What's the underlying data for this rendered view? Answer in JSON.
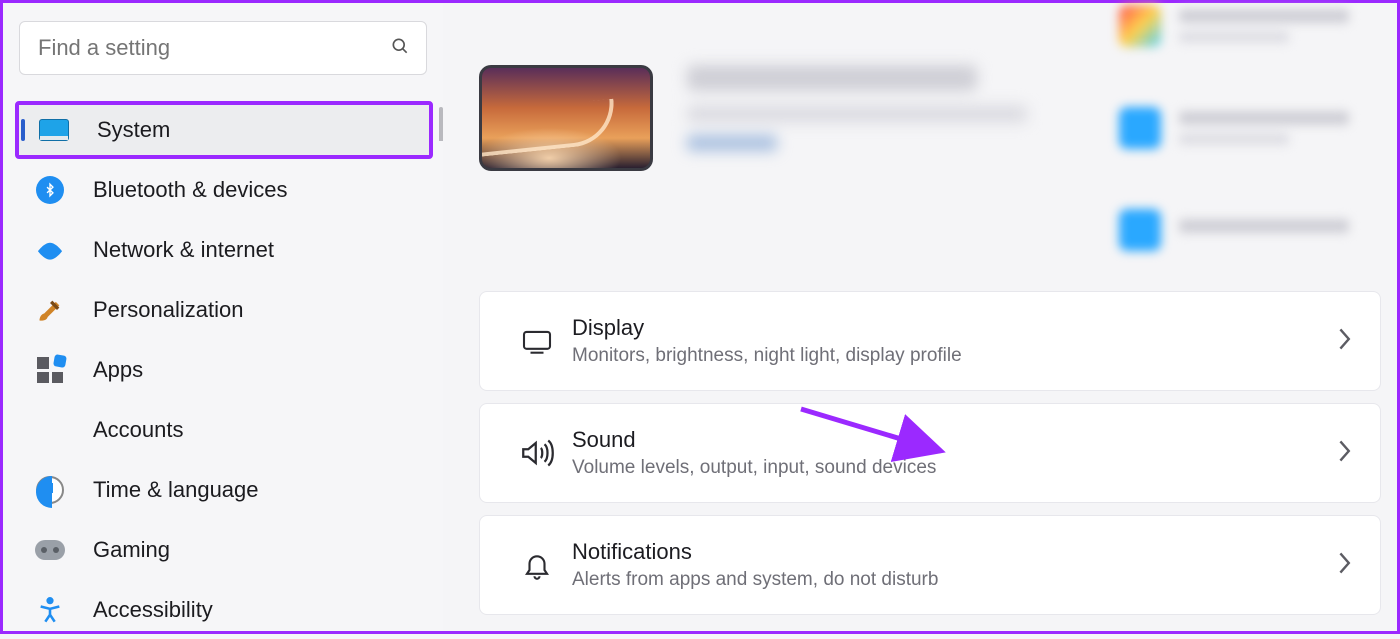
{
  "search": {
    "placeholder": "Find a setting"
  },
  "sidebar": {
    "items": [
      {
        "label": "System",
        "icon": "system",
        "selected": true
      },
      {
        "label": "Bluetooth & devices",
        "icon": "bluetooth"
      },
      {
        "label": "Network & internet",
        "icon": "network"
      },
      {
        "label": "Personalization",
        "icon": "personalization"
      },
      {
        "label": "Apps",
        "icon": "apps"
      },
      {
        "label": "Accounts",
        "icon": "accounts"
      },
      {
        "label": "Time & language",
        "icon": "time"
      },
      {
        "label": "Gaming",
        "icon": "gaming"
      },
      {
        "label": "Accessibility",
        "icon": "accessibility"
      }
    ]
  },
  "cards": [
    {
      "title": "Display",
      "desc": "Monitors, brightness, night light, display profile",
      "icon": "display"
    },
    {
      "title": "Sound",
      "desc": "Volume levels, output, input, sound devices",
      "icon": "sound"
    },
    {
      "title": "Notifications",
      "desc": "Alerts from apps and system, do not disturb",
      "icon": "notifications"
    }
  ],
  "annotation": {
    "highlight_item": "System",
    "arrow_target": "Sound",
    "color": "#9b29ff"
  }
}
